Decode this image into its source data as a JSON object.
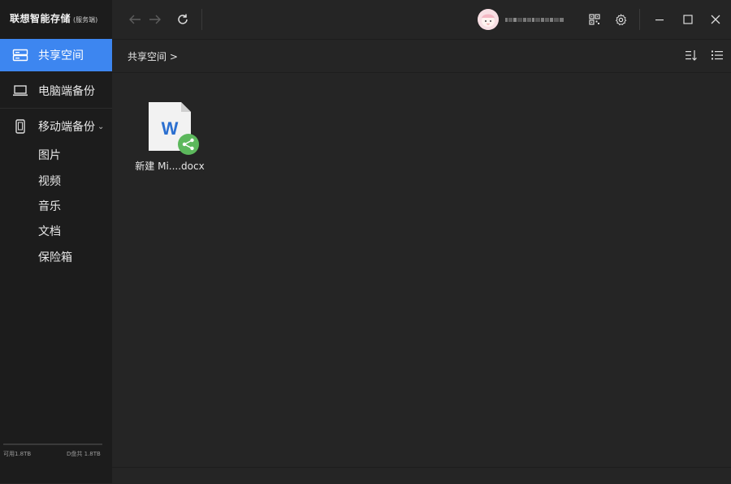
{
  "app": {
    "brand_main": "联想智能存储",
    "brand_sub": "(服务端)"
  },
  "sidebar": {
    "items": [
      {
        "label": "共享空间",
        "icon": "shared-drive-icon",
        "active": true
      },
      {
        "label": "电脑端备份",
        "icon": "laptop-icon",
        "active": false
      },
      {
        "label": "移动端备份",
        "icon": "phone-icon",
        "active": false
      }
    ],
    "mobile_chevron": "⌄",
    "sub_items": [
      "图片",
      "视频",
      "音乐",
      "文档",
      "保险箱"
    ],
    "storage": {
      "available": "可用1.8TB",
      "disk": "D盘共 1.8TB",
      "used_fraction": 0.0
    }
  },
  "toolbar": {
    "back_icon": "arrow-left-icon",
    "forward_icon": "arrow-right-icon",
    "refresh_icon": "refresh-icon",
    "qr_icon": "qr-code-icon",
    "settings_icon": "gear-icon",
    "minimize_icon": "minimize-icon",
    "maximize_icon": "maximize-icon",
    "close_icon": "close-icon"
  },
  "breadcrumb": {
    "path": "共享空间 >"
  },
  "view": {
    "sort_icon": "sort-icon",
    "list_icon": "list-view-icon"
  },
  "files": [
    {
      "name": "新建 Mi....docx",
      "type_letter": "W",
      "shared": true
    }
  ],
  "colors": {
    "accent": "#3d86f0",
    "word_blue": "#2b6fd0",
    "share_green": "#5cb85c"
  }
}
